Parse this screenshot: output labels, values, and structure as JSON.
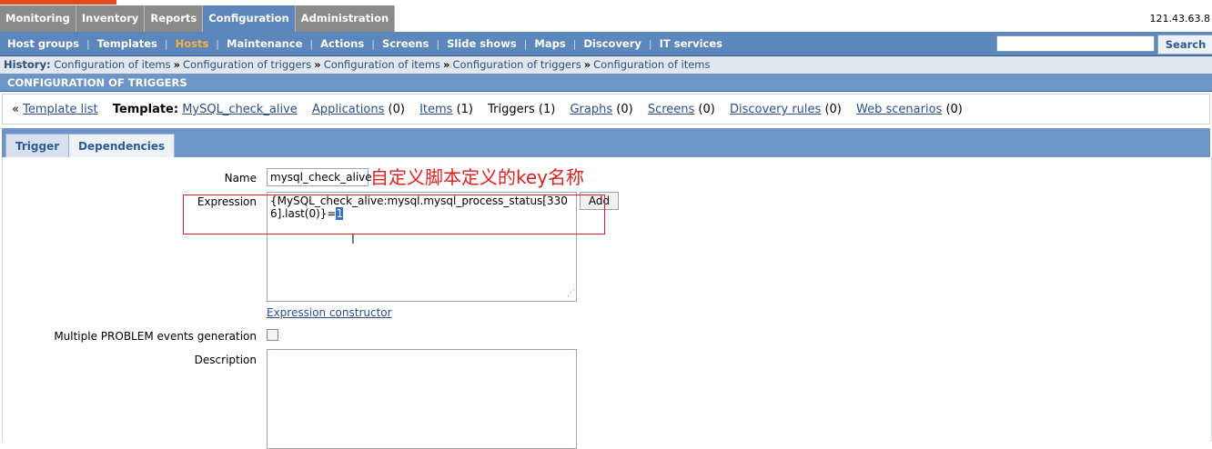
{
  "top_menu": {
    "items": [
      "Monitoring",
      "Inventory",
      "Reports",
      "Configuration",
      "Administration"
    ],
    "active": "Configuration",
    "ip": "121.43.63.8"
  },
  "sub_menu": {
    "items": [
      "Host groups",
      "Templates",
      "Hosts",
      "Maintenance",
      "Actions",
      "Screens",
      "Slide shows",
      "Maps",
      "Discovery",
      "IT services"
    ],
    "active": "Hosts",
    "search_button": "Search"
  },
  "history": {
    "label": "History:",
    "items": [
      "Configuration of items",
      "Configuration of triggers",
      "Configuration of items",
      "Configuration of triggers",
      "Configuration of items"
    ]
  },
  "page_title": "CONFIGURATION OF TRIGGERS",
  "header": {
    "back_prefix": "«",
    "template_list": "Template list",
    "template_label": "Template:",
    "template_name": "MySQL_check_alive",
    "applications": "Applications",
    "applications_count": "(0)",
    "items": "Items",
    "items_count": "(1)",
    "triggers": "Triggers (1)",
    "graphs": "Graphs",
    "graphs_count": "(0)",
    "screens": "Screens",
    "screens_count": "(0)",
    "discovery": "Discovery rules",
    "discovery_count": "(0)",
    "web": "Web scenarios",
    "web_count": "(0)"
  },
  "tabs": {
    "trigger": "Trigger",
    "dependencies": "Dependencies"
  },
  "form": {
    "name_label": "Name",
    "name_value": "mysql_check_alive",
    "annotation": "自定义脚本定义的key名称",
    "expression_label": "Expression",
    "expression_value": "{MySQL_check_alive:mysql.mysql_process_status[3306].last(0)}=",
    "expression_selected": "1",
    "add_button": "Add",
    "expression_constructor": "Expression constructor",
    "multiple_label": "Multiple PROBLEM events generation",
    "description_label": "Description"
  },
  "colors": {
    "accent": "#5c87bd",
    "active_submenu": "#f7b13a",
    "annotation": "#e02020"
  }
}
